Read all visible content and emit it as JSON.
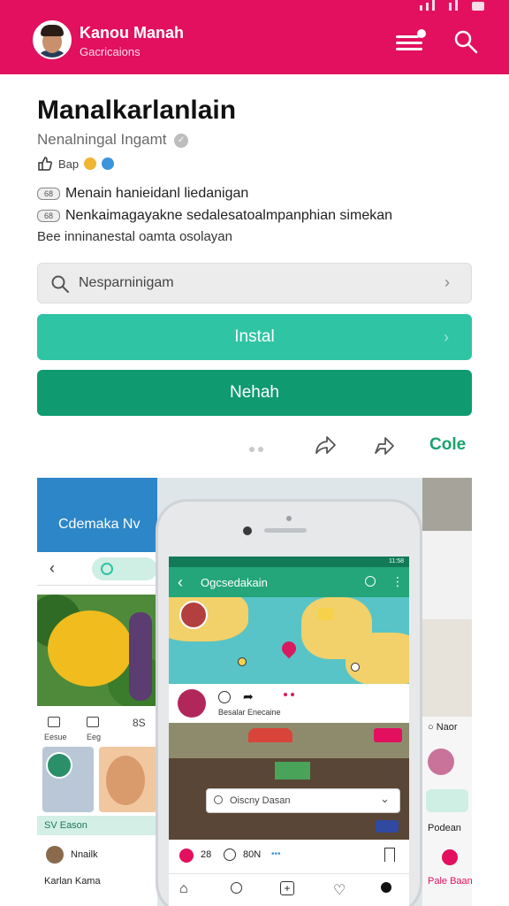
{
  "colors": {
    "brand": "#e2105f",
    "install": "#2fc4a4",
    "open": "#109a70",
    "accent_text": "#1aa26e"
  },
  "header": {
    "name": "Kanou Manah",
    "subtitle": "Gacricaions"
  },
  "app": {
    "title": "Manalkarlanlain",
    "developer": "Nenalningal Ingamt",
    "rating_label": "Bap",
    "desc_line1": "Menain hanieidanl liedanigan",
    "desc_line2": "Nenkaimagayakne sedalesatoalmpanphian simekan",
    "desc_line3": "Bee inninanestal oamta osolayan",
    "pill1": "68",
    "pill2": "68"
  },
  "search": {
    "value": "Nesparninigam"
  },
  "buttons": {
    "install": "Instal",
    "open": "Nehah",
    "cole": "Cole"
  },
  "gallery": {
    "left_title": "Cdemaka Nv",
    "left_icon1": "Eesue",
    "left_icon2": "Eeg",
    "left_count": "8S",
    "left_banner": "SV Eason",
    "left_user": "Nnailk",
    "left_user2": "Karlan Kama",
    "right_label1": "Naor",
    "right_label2": "Pale Baan",
    "right_label3": "Podean",
    "screen_status": "11:58",
    "screen_title": "Ogcsedakain",
    "screen_sub": "Besalar Enecaine",
    "screen_search": "Oiscny Dasan",
    "screen_count": "28",
    "screen_count2": "80N"
  }
}
